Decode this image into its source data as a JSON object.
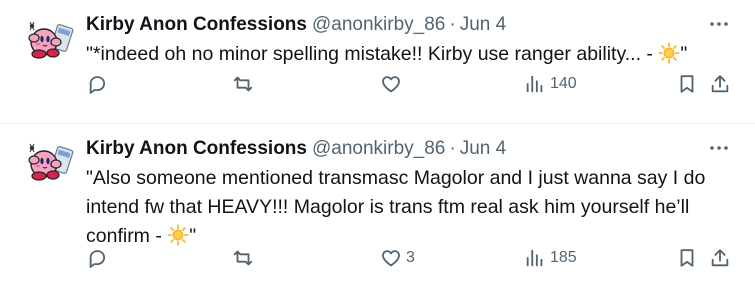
{
  "tweets": [
    {
      "name": "Kirby Anon Confessions",
      "handle": "@anonkirby_86",
      "dot": "·",
      "date": "Jun 4",
      "text_before": "\"*indeed oh no minor spelling mistake!! Kirby use ranger ability... - ",
      "emoji": "star-emoji",
      "text_after": "\"",
      "replies": "",
      "retweets": "",
      "likes": "",
      "views": "140"
    },
    {
      "name": "Kirby Anon Confessions",
      "handle": "@anonkirby_86",
      "dot": "·",
      "date": "Jun 4",
      "text_before": "\"Also someone mentioned transmasc Magolor and I just wanna say I do intend fw that HEAVY!!! Magolor is trans ftm real ask him yourself he’ll confirm - ",
      "emoji": "star-emoji",
      "text_after": "\"",
      "replies": "",
      "retweets": "",
      "likes": "3",
      "views": "185"
    }
  ],
  "colors": {
    "text": "#0f1419",
    "secondary": "#536471",
    "divider": "#eff3f4",
    "kirby_pink": "#f4a3c0",
    "star": "#f7b733"
  }
}
